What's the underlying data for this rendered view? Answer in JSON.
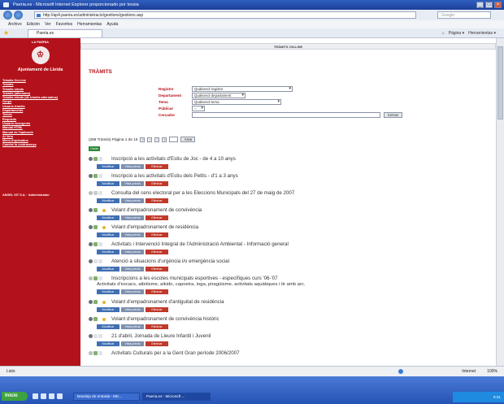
{
  "window": {
    "title": "Paeria.es - Microsoft Internet Explorer proporcionado por Iessia",
    "controls": [
      "_",
      "□",
      "×"
    ]
  },
  "address": {
    "url": "http://ap4.paeria.es/administracio/gestions/gestions.asp",
    "search_placeholder": "Google"
  },
  "menu": [
    "Archivo",
    "Edición",
    "Ver",
    "Favoritos",
    "Herramientas",
    "Ayuda"
  ],
  "tab": {
    "label": "Paeria.es"
  },
  "toolbar": {
    "page_label": "Página ▾",
    "tools_label": "Herramientas ▾"
  },
  "sidebar": {
    "top_text": "LA PAERIA",
    "brand": "Ajuntament de Lleida",
    "items": [
      "Tràmits On-Line",
      "Tràmits",
      "Tràmits rebuts",
      "Tràmits (alternatiu)",
      "Tràmits rebuts (de tràmits alternatius)",
      "Grups",
      "Usuaris tràmits",
      "Departaments",
      "Temes",
      "Requisits",
      "Usuaris emergents",
      "Manual HTML",
      "Manual de l'aplicació",
      "Ai Vera",
      "Menú d'aplicatius",
      "Canviar la contrasenya"
    ],
    "footer": "ANGEL SIT S.A. · Administrador"
  },
  "header": {
    "title": "TRÀMITS ON-LINE"
  },
  "page_title": "TRÀMITS",
  "filters": {
    "registre": {
      "label": "Registre",
      "value": "Qualsevol registre"
    },
    "departament": {
      "label": "Departament",
      "value": "Qualsevol departament"
    },
    "tema": {
      "label": "Tema",
      "value": "Qualsevol tema"
    },
    "public": {
      "label": "Públicar",
      "value": "--"
    },
    "cercador": {
      "label": "Cercador",
      "value": "",
      "button": "Cercar"
    }
  },
  "pager": {
    "summary": "(288 Tràmits) Pàgina 1 de 15",
    "go_label": "Anar"
  },
  "create_button": "Crear",
  "row_buttons": {
    "modify": "Modificar",
    "preview": "Vista prèvia",
    "delete": "Eliminar"
  },
  "rows": [
    {
      "title": "Inscripció a les activitats d'Estiu de Joc - de 4 a 10 anys",
      "sub": ""
    },
    {
      "title": "Inscripció a les activitats d'Estiu dels Petits - d'1 a 3 anys",
      "sub": ""
    },
    {
      "title": "Consulta del cens electoral per a les Eleccions Municipals del 27 de maig de 2007",
      "sub": ""
    },
    {
      "title": "Volant d'empadronament de convivència",
      "sub": ""
    },
    {
      "title": "Volant d'empadronament de residència",
      "sub": ""
    },
    {
      "title": "Activitats i Intervenció Integral de l'Administració Ambiental - Informació general",
      "sub": ""
    },
    {
      "title": "Atenció a situacions d'urgència i/o emergència social",
      "sub": ""
    },
    {
      "title": "Inscripcions a les escoles municipals esportives - específiques curs '06-'07",
      "sub": "Activitats d'escacs, atletisme, aikido, capoeira, ioga, piragüisme, activitats aquàtiques i tir amb arc."
    },
    {
      "title": "Volant d'empadronament d'antiguitat de residència",
      "sub": ""
    },
    {
      "title": "Volant d'empadronament de convivència històric",
      "sub": ""
    },
    {
      "title": "21 d'abril, Jornada de Lleure Infantil i Juvenil",
      "sub": ""
    },
    {
      "title": "Activitats Culturals per a la Gent Gran període 2006/2007",
      "sub": ""
    }
  ],
  "status": {
    "left": "Listo",
    "zone": "Internet",
    "zoom": "100%"
  },
  "taskbar": {
    "start": "Inicio",
    "tasks": [
      "Bandeja de entrada - Mic...",
      "Paeria.es - Microsoft ..."
    ],
    "clock": "9:31"
  }
}
